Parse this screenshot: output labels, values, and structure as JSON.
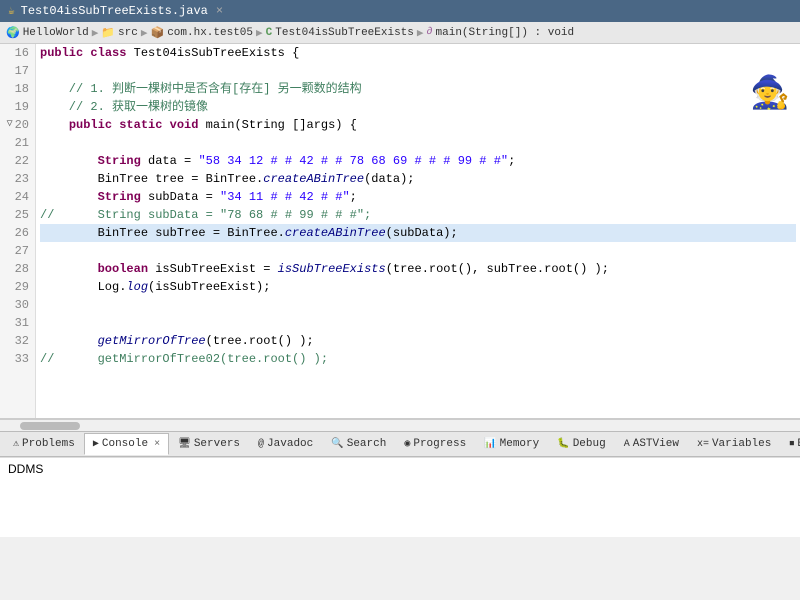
{
  "title_bar": {
    "filename": "Test04isSubTreeExists.java",
    "close_icon": "×"
  },
  "breadcrumb": {
    "items": [
      {
        "label": "HelloWorld",
        "icon": "H"
      },
      {
        "label": "src",
        "icon": "📁"
      },
      {
        "label": "com.hx.test05",
        "icon": "📦"
      },
      {
        "label": "Test04isSubTreeExists",
        "icon": "C"
      },
      {
        "label": "main(String[]) : void",
        "icon": "m"
      }
    ],
    "separators": [
      "▶",
      "▶",
      "▶",
      "▶"
    ]
  },
  "code_lines": [
    {
      "num": "16",
      "fold": false,
      "content": "public class Test04isSubTreeExists {",
      "highlight": false
    },
    {
      "num": "17",
      "fold": false,
      "content": "",
      "highlight": false
    },
    {
      "num": "18",
      "fold": false,
      "content": "    // 1. 判断一棵树中是否含有[存在] 另一颗数的结构",
      "highlight": false
    },
    {
      "num": "19",
      "fold": false,
      "content": "    // 2. 获取一棵树的镜像",
      "highlight": false
    },
    {
      "num": "20",
      "fold": true,
      "content": "    public static void main(String []args) {",
      "highlight": false
    },
    {
      "num": "21",
      "fold": false,
      "content": "",
      "highlight": false
    },
    {
      "num": "22",
      "fold": false,
      "content": "        String data = \"58 34 12 # # 42 # # 78 68 69 # # # 99 # #\";",
      "highlight": false
    },
    {
      "num": "23",
      "fold": false,
      "content": "        BinTree tree = BinTree.createABinTree(data);",
      "highlight": false
    },
    {
      "num": "24",
      "fold": false,
      "content": "        String subData = \"34 11 # # 42 # #\";",
      "highlight": false
    },
    {
      "num": "25",
      "fold": false,
      "content": "//      String subData = \"78 68 # # 99 # # #\";",
      "highlight": false
    },
    {
      "num": "26",
      "fold": false,
      "content": "        BinTree subTree = BinTree.createABinTree(subData);",
      "highlight": true
    },
    {
      "num": "27",
      "fold": false,
      "content": "",
      "highlight": false
    },
    {
      "num": "28",
      "fold": false,
      "content": "        boolean isSubTreeExist = isSubTreeExists(tree.root(), subTree.root() );",
      "highlight": false
    },
    {
      "num": "29",
      "fold": false,
      "content": "        Log.log(isSubTreeExist);",
      "highlight": false
    },
    {
      "num": "30",
      "fold": false,
      "content": "",
      "highlight": false
    },
    {
      "num": "31",
      "fold": false,
      "content": "",
      "highlight": false
    },
    {
      "num": "32",
      "fold": false,
      "content": "        getMirrorOfTree(tree.root() );",
      "highlight": false
    },
    {
      "num": "33",
      "fold": false,
      "content": "//      getMirrorOfTree02(tree.root() );",
      "highlight": false
    }
  ],
  "bottom_tabs": [
    {
      "label": "Problems",
      "icon": "⚠",
      "active": false
    },
    {
      "label": "Console",
      "icon": "▶",
      "active": true,
      "closeable": true
    },
    {
      "label": "Servers",
      "icon": "🖥",
      "active": false
    },
    {
      "label": "Javadoc",
      "icon": "@",
      "active": false
    },
    {
      "label": "Search",
      "icon": "🔍",
      "active": false
    },
    {
      "label": "Progress",
      "icon": "◉",
      "active": false
    },
    {
      "label": "Memory",
      "icon": "📊",
      "active": false
    },
    {
      "label": "Debug",
      "icon": "🐛",
      "active": false
    },
    {
      "label": "ASTView",
      "icon": "A",
      "active": false
    },
    {
      "label": "Variables",
      "icon": "x=",
      "active": false
    },
    {
      "label": "Breakp...",
      "icon": "⏹",
      "active": false
    }
  ],
  "console": {
    "content": "DDMS"
  },
  "figure": "🧙"
}
